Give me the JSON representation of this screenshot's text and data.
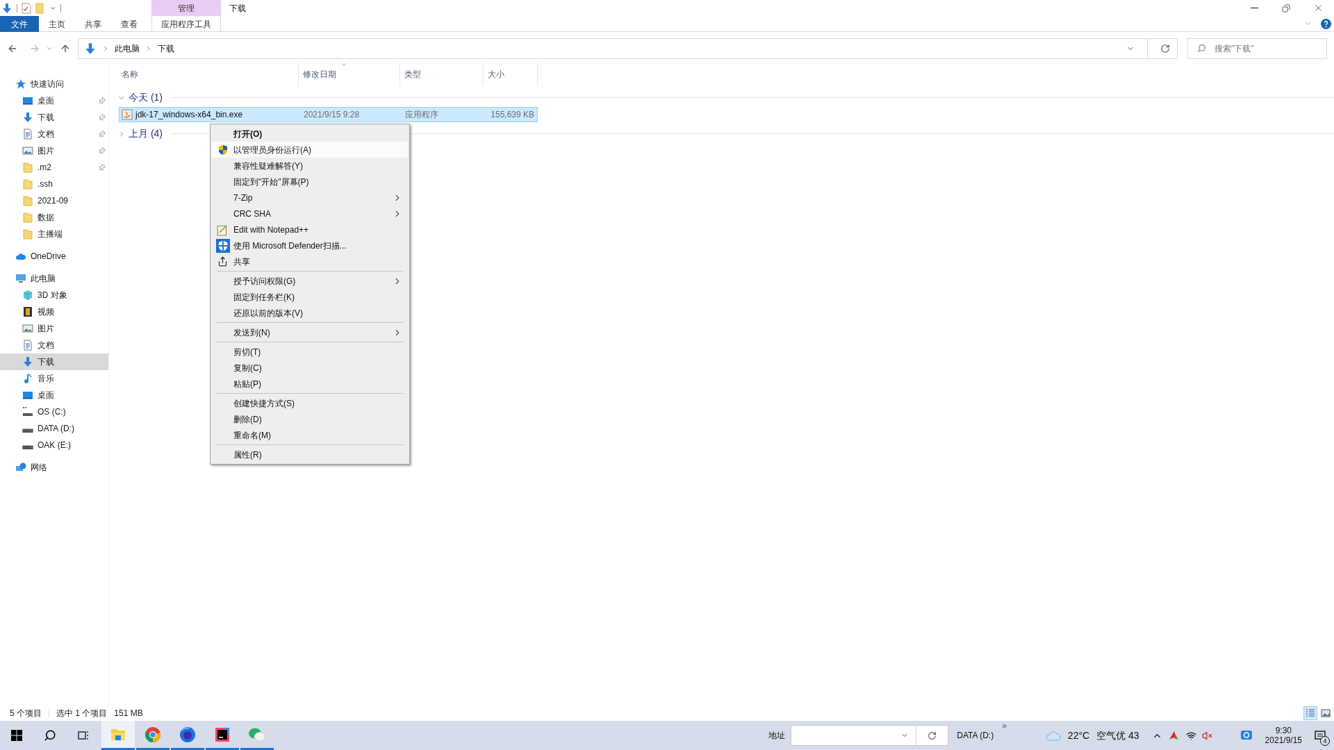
{
  "window": {
    "title": "下载",
    "context_tab": "管理"
  },
  "ribbon": {
    "tabs": [
      {
        "label": "文件",
        "kind": "file"
      },
      {
        "label": "主页",
        "kind": "tab"
      },
      {
        "label": "共享",
        "kind": "tab"
      },
      {
        "label": "查看",
        "kind": "tab"
      },
      {
        "label": "应用程序工具",
        "kind": "context"
      }
    ]
  },
  "address": {
    "path": [
      "此电脑",
      "下载"
    ]
  },
  "search": {
    "placeholder": "搜索\"下载\""
  },
  "sidebar": {
    "items": [
      {
        "label": "快速访问",
        "kind": "star",
        "selected": false,
        "children": [
          {
            "label": "桌面",
            "kind": "desktop",
            "pinned": true,
            "selected": false
          },
          {
            "label": "下载",
            "kind": "download",
            "pinned": true,
            "selected": false
          },
          {
            "label": "文档",
            "kind": "document",
            "pinned": true,
            "selected": false
          },
          {
            "label": "图片",
            "kind": "pictures",
            "pinned": true,
            "selected": false
          },
          {
            "label": ".m2",
            "kind": "folder",
            "pinned": true,
            "selected": false
          },
          {
            "label": ".ssh",
            "kind": "folder",
            "pinned": false,
            "selected": false
          },
          {
            "label": "2021-09",
            "kind": "folder",
            "pinned": false,
            "selected": false
          },
          {
            "label": "数据",
            "kind": "folder",
            "pinned": false,
            "selected": false
          },
          {
            "label": "主播端",
            "kind": "folder",
            "pinned": false,
            "selected": false
          }
        ]
      },
      {
        "label": "OneDrive",
        "kind": "cloud",
        "selected": false
      },
      {
        "label": "此电脑",
        "kind": "pc",
        "selected": false,
        "children": [
          {
            "label": "3D 对象",
            "kind": "cube",
            "pinned": false,
            "selected": false
          },
          {
            "label": "视频",
            "kind": "video",
            "pinned": false,
            "selected": false
          },
          {
            "label": "图片",
            "kind": "pictures",
            "pinned": false,
            "selected": false
          },
          {
            "label": "文档",
            "kind": "document",
            "pinned": false,
            "selected": false
          },
          {
            "label": "下载",
            "kind": "download",
            "pinned": false,
            "selected": true
          },
          {
            "label": "音乐",
            "kind": "music",
            "pinned": false,
            "selected": false
          },
          {
            "label": "桌面",
            "kind": "desktop",
            "pinned": false,
            "selected": false
          },
          {
            "label": "OS (C:)",
            "kind": "osdrive",
            "pinned": false,
            "selected": false
          },
          {
            "label": "DATA (D:)",
            "kind": "drive",
            "pinned": false,
            "selected": false
          },
          {
            "label": "OAK (E:)",
            "kind": "drive",
            "pinned": false,
            "selected": false
          }
        ]
      },
      {
        "label": "网络",
        "kind": "network",
        "selected": false
      }
    ]
  },
  "columns": [
    {
      "label": "名称",
      "sorted": false
    },
    {
      "label": "修改日期",
      "sorted": true
    },
    {
      "label": "类型",
      "sorted": false
    },
    {
      "label": "大小",
      "sorted": false
    }
  ],
  "groups": [
    {
      "label": "今天 (1)",
      "expanded": true,
      "files": [
        {
          "name": "jdk-17_windows-x64_bin.exe",
          "date": "2021/9/15 9:28",
          "type": "应用程序",
          "size": "155,639 KB",
          "selected": true
        }
      ]
    },
    {
      "label": "上月 (4)",
      "expanded": false
    }
  ],
  "context_menu": {
    "sections": [
      [
        {
          "label": "打开(O)",
          "kind": "plain",
          "default": true,
          "highlighted": false,
          "submenu": false
        },
        {
          "label": "以管理员身份运行(A)",
          "kind": "shield",
          "default": false,
          "highlighted": true,
          "submenu": false
        },
        {
          "label": "兼容性疑难解答(Y)",
          "default": false,
          "highlighted": false,
          "submenu": false
        },
        {
          "label": "固定到\"开始\"屏幕(P)",
          "default": false,
          "highlighted": false,
          "submenu": false
        },
        {
          "label": "7-Zip",
          "default": false,
          "highlighted": false,
          "submenu": true
        },
        {
          "label": "CRC SHA",
          "default": false,
          "highlighted": false,
          "submenu": true
        },
        {
          "label": "Edit with Notepad++",
          "kind": "notepad",
          "default": false,
          "highlighted": false,
          "submenu": false
        },
        {
          "label": "使用 Microsoft Defender扫描...",
          "kind": "defender",
          "default": false,
          "highlighted": false,
          "submenu": false
        },
        {
          "label": "共享",
          "kind": "share",
          "default": false,
          "highlighted": false,
          "submenu": false
        }
      ],
      [
        {
          "label": "授予访问权限(G)",
          "default": false,
          "highlighted": false,
          "submenu": true
        },
        {
          "label": "固定到任务栏(K)",
          "default": false,
          "highlighted": false,
          "submenu": false
        },
        {
          "label": "还原以前的版本(V)",
          "default": false,
          "highlighted": false,
          "submenu": false
        }
      ],
      [
        {
          "label": "发送到(N)",
          "default": false,
          "highlighted": false,
          "submenu": true
        }
      ],
      [
        {
          "label": "剪切(T)",
          "default": false,
          "highlighted": false,
          "submenu": false
        },
        {
          "label": "复制(C)",
          "default": false,
          "highlighted": false,
          "submenu": false
        },
        {
          "label": "粘贴(P)",
          "default": false,
          "highlighted": false,
          "submenu": false
        }
      ],
      [
        {
          "label": "创建快捷方式(S)",
          "default": false,
          "highlighted": false,
          "submenu": false
        },
        {
          "label": "删除(D)",
          "default": false,
          "highlighted": false,
          "submenu": false
        },
        {
          "label": "重命名(M)",
          "default": false,
          "highlighted": false,
          "submenu": false
        }
      ],
      [
        {
          "label": "属性(R)",
          "default": false,
          "highlighted": false,
          "submenu": false
        }
      ]
    ]
  },
  "status_bar": {
    "item_count": "5 个项目",
    "selection": "选中 1 个项目",
    "selection_size": "151 MB",
    "views": [
      {
        "kind": "details",
        "selected": true
      },
      {
        "kind": "large",
        "selected": false
      }
    ]
  },
  "taskbar": {
    "apps": [
      {
        "kind": "explorer",
        "active": true
      },
      {
        "kind": "chrome",
        "active": false
      },
      {
        "kind": "firefox",
        "active": false
      },
      {
        "kind": "intellij",
        "active": false
      },
      {
        "kind": "wechat",
        "active": false
      }
    ],
    "address_toolbar": {
      "label": "地址",
      "drive": "DATA (D:)",
      "overflow": "»"
    },
    "weather": {
      "temperature": "22°C",
      "air": "空气优 43"
    },
    "clock": {
      "time": "9:30",
      "date": "2021/9/15"
    },
    "notifications": {
      "count": "4"
    }
  }
}
